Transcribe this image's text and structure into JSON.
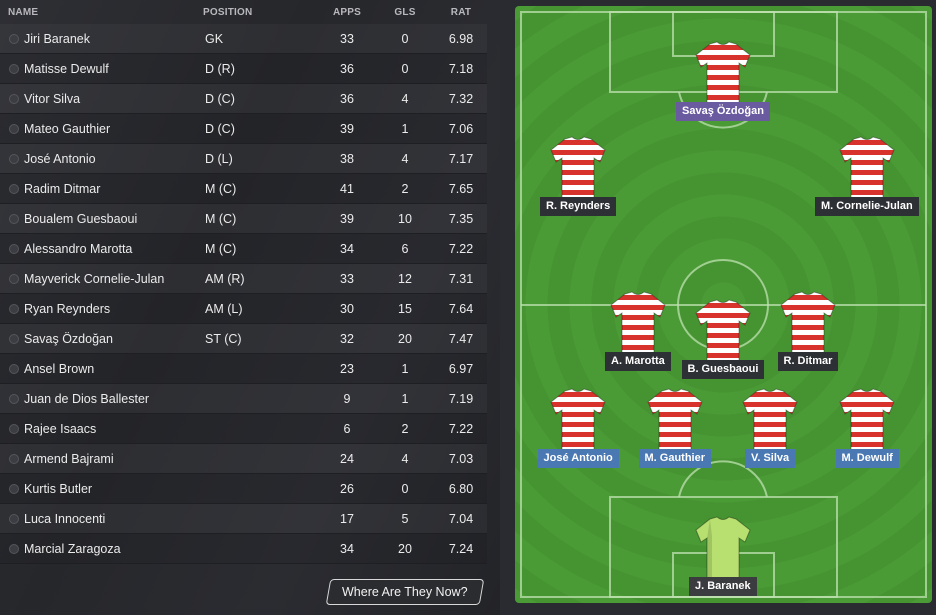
{
  "table": {
    "headers": {
      "name": "NAME",
      "position": "POSITION",
      "apps": "APPS",
      "gls": "GLS",
      "rat": "RAT"
    },
    "rows": [
      {
        "name": "Jiri Baranek",
        "position": "GK",
        "apps": "33",
        "gls": "0",
        "rat": "6.98"
      },
      {
        "name": "Matisse Dewulf",
        "position": "D (R)",
        "apps": "36",
        "gls": "0",
        "rat": "7.18"
      },
      {
        "name": "Vitor Silva",
        "position": "D (C)",
        "apps": "36",
        "gls": "4",
        "rat": "7.32"
      },
      {
        "name": "Mateo Gauthier",
        "position": "D (C)",
        "apps": "39",
        "gls": "1",
        "rat": "7.06"
      },
      {
        "name": "José Antonio",
        "position": "D (L)",
        "apps": "38",
        "gls": "4",
        "rat": "7.17"
      },
      {
        "name": "Radim Ditmar",
        "position": "M (C)",
        "apps": "41",
        "gls": "2",
        "rat": "7.65"
      },
      {
        "name": "Boualem Guesbaoui",
        "position": "M (C)",
        "apps": "39",
        "gls": "10",
        "rat": "7.35"
      },
      {
        "name": "Alessandro Marotta",
        "position": "M (C)",
        "apps": "34",
        "gls": "6",
        "rat": "7.22"
      },
      {
        "name": "Mayverick Cornelie-Julan",
        "position": "AM (R)",
        "apps": "33",
        "gls": "12",
        "rat": "7.31"
      },
      {
        "name": "Ryan Reynders",
        "position": "AM (L)",
        "apps": "30",
        "gls": "15",
        "rat": "7.64"
      },
      {
        "name": "Savaş Özdoğan",
        "position": "ST (C)",
        "apps": "32",
        "gls": "20",
        "rat": "7.47"
      },
      {
        "name": "Ansel Brown",
        "position": "",
        "apps": "23",
        "gls": "1",
        "rat": "6.97"
      },
      {
        "name": "Juan de Dios Ballester",
        "position": "",
        "apps": "9",
        "gls": "1",
        "rat": "7.19"
      },
      {
        "name": "Rajee Isaacs",
        "position": "",
        "apps": "6",
        "gls": "2",
        "rat": "7.22"
      },
      {
        "name": "Armend Bajrami",
        "position": "",
        "apps": "24",
        "gls": "4",
        "rat": "7.03"
      },
      {
        "name": "Kurtis Butler",
        "position": "",
        "apps": "26",
        "gls": "0",
        "rat": "6.80"
      },
      {
        "name": "Luca Innocenti",
        "position": "",
        "apps": "17",
        "gls": "5",
        "rat": "7.04"
      },
      {
        "name": "Marcial Zaragoza",
        "position": "",
        "apps": "34",
        "gls": "20",
        "rat": "7.24"
      }
    ]
  },
  "button": {
    "where_label": "Where Are They Now?"
  },
  "pitch": {
    "players": {
      "st": "Savaş Özdoğan",
      "aml": "R. Reynders",
      "amr": "M. Cornelie-Julan",
      "mcl": "A. Marotta",
      "mc": "B. Guesbaoui",
      "mcr": "R. Ditmar",
      "dl": "José Antonio",
      "dcl": "M. Gauthier",
      "dcr": "V. Silva",
      "dr": "M. Dewulf",
      "gk": "J. Baranek"
    }
  },
  "colors": {
    "pitch_green": "#4a9a36",
    "shirt_red": "#d8322c",
    "shirt_white": "#ffffff",
    "gk_shirt": "#b8e070",
    "label_dark": "#2d3034",
    "label_purple": "#6a5aa0",
    "label_blue": "#4a78b2"
  },
  "icons": {
    "row_marker": "status-dot-icon",
    "shirt": "striped-shirt-icon",
    "gk_shirt": "goalkeeper-shirt-icon"
  }
}
